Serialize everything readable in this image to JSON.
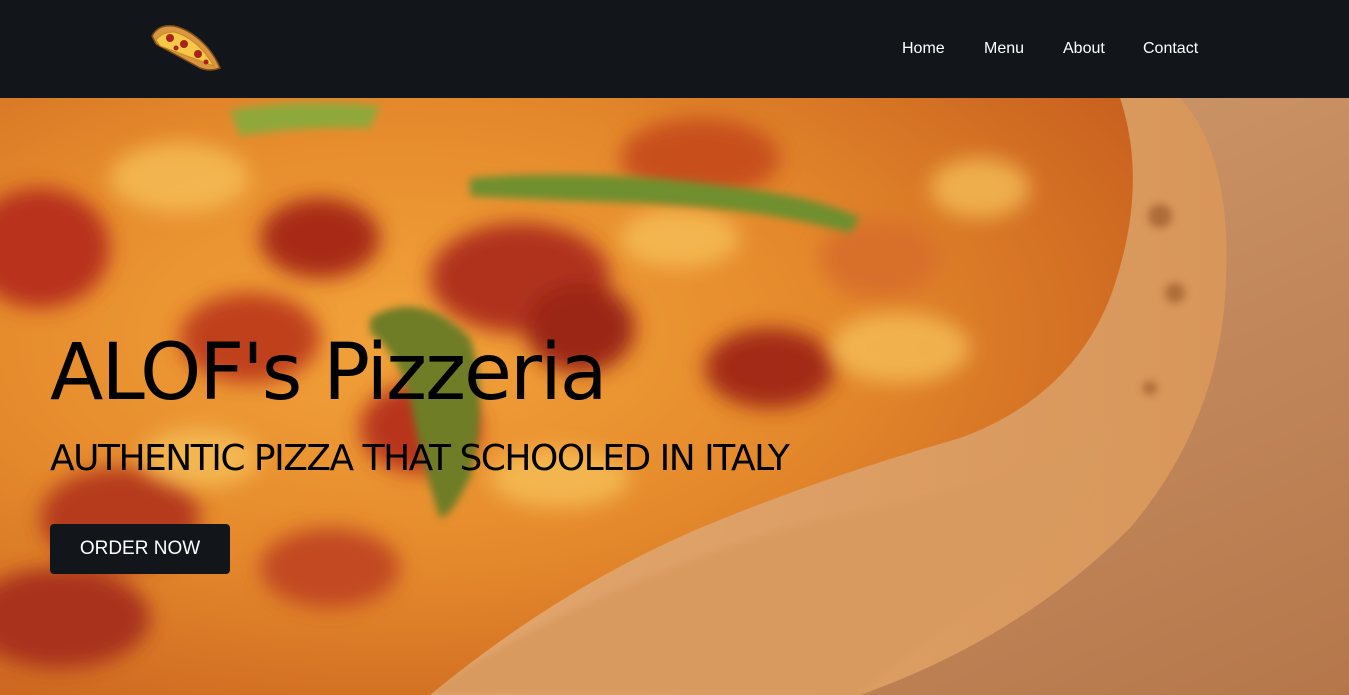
{
  "nav": {
    "logo_icon": "pizza-slice-icon",
    "links": [
      {
        "label": "Home"
      },
      {
        "label": "Menu"
      },
      {
        "label": "About"
      },
      {
        "label": "Contact"
      }
    ]
  },
  "hero": {
    "background_image": "pizza-closeup",
    "title": "ALOF's Pizzeria",
    "subtitle": "AUTHENTIC PIZZA THAT SCHOOLED IN ITALY",
    "cta_label": "ORDER NOW"
  },
  "colors": {
    "navbar_bg": "#12161b",
    "nav_text": "#ffffff",
    "hero_text": "#000000",
    "button_bg": "#12161b",
    "button_text": "#ffffff"
  }
}
